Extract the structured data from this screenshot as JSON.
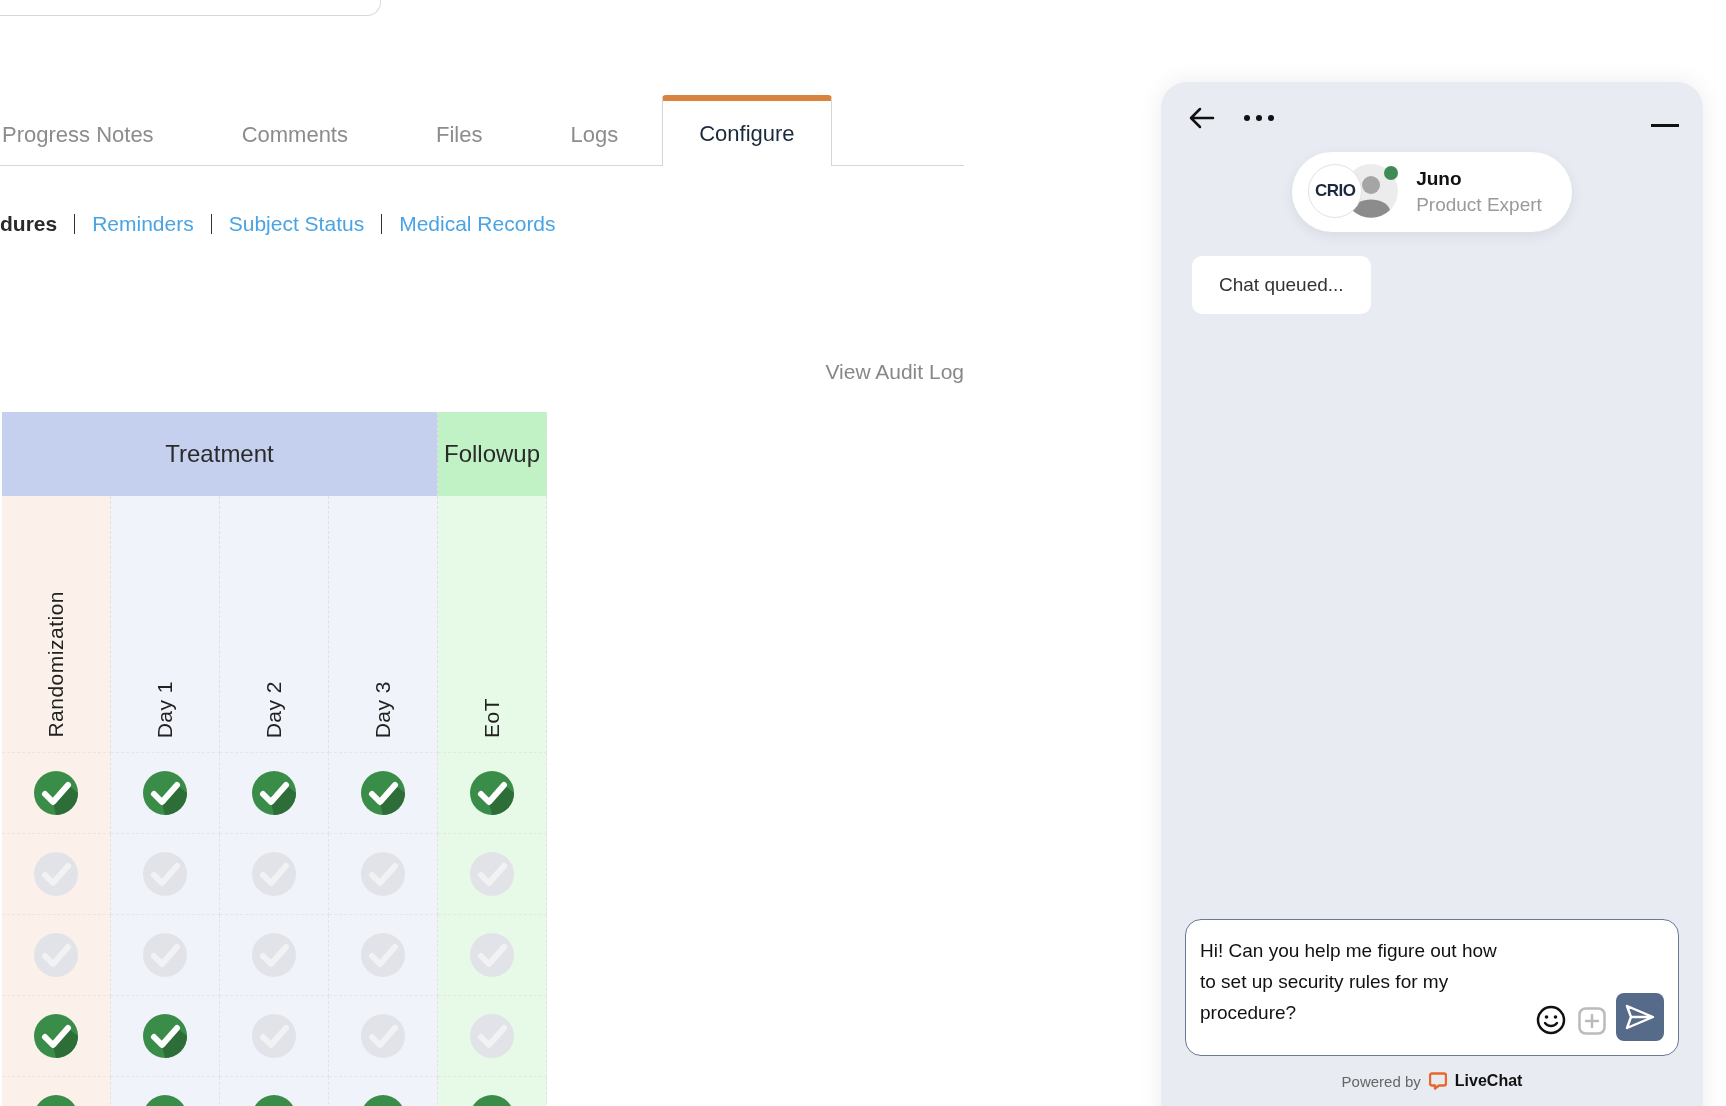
{
  "tabs": [
    {
      "label": "Progress Notes",
      "selected": false
    },
    {
      "label": "Comments",
      "selected": false
    },
    {
      "label": "Files",
      "selected": false
    },
    {
      "label": "Logs",
      "selected": false
    },
    {
      "label": "Configure",
      "selected": true
    }
  ],
  "subnav": [
    {
      "label": "dures",
      "selected": true
    },
    {
      "label": "Reminders",
      "selected": false
    },
    {
      "label": "Subject Status",
      "selected": false
    },
    {
      "label": "Medical Records",
      "selected": false
    }
  ],
  "audit_link": "View Audit Log",
  "table": {
    "groups": [
      {
        "label": "Treatment",
        "color": "#c5cfee",
        "columns": [
          {
            "label": "Randomization",
            "color": "#fbf1ea"
          },
          {
            "label": "Day 1",
            "color": "#f1f3fb"
          },
          {
            "label": "Day 2",
            "color": "#f1f3fb"
          },
          {
            "label": "Day 3",
            "color": "#f1f3fb"
          }
        ]
      },
      {
        "label": "Followup",
        "color": "#c1f2c6",
        "columns": [
          {
            "label": "EoT",
            "color": "#e6fae7"
          }
        ]
      }
    ],
    "rows": [
      {
        "cells": [
          {
            "checked": true
          },
          {
            "checked": true
          },
          {
            "checked": true
          },
          {
            "checked": true
          },
          {
            "checked": true
          }
        ]
      },
      {
        "cells": [
          {
            "checked": false
          },
          {
            "checked": false
          },
          {
            "checked": false
          },
          {
            "checked": false
          },
          {
            "checked": false
          }
        ]
      },
      {
        "cells": [
          {
            "checked": false
          },
          {
            "checked": false
          },
          {
            "checked": false
          },
          {
            "checked": false
          },
          {
            "checked": false
          }
        ]
      },
      {
        "cells": [
          {
            "checked": true
          },
          {
            "checked": true
          },
          {
            "checked": false
          },
          {
            "checked": false
          },
          {
            "checked": false
          }
        ]
      },
      {
        "cells": [
          {
            "checked": true
          },
          {
            "checked": true
          },
          {
            "checked": true
          },
          {
            "checked": true
          },
          {
            "checked": true
          }
        ]
      }
    ]
  },
  "chat": {
    "logo": "CRIO",
    "agent": {
      "name": "Juno",
      "role": "Product Expert",
      "online": true
    },
    "messages": [
      "Chat queued..."
    ],
    "input": {
      "value": "Hi! Can you help me figure out how to set up security rules for my procedure?"
    },
    "footer": {
      "text": "Powered by",
      "brand": "LiveChat"
    }
  }
}
